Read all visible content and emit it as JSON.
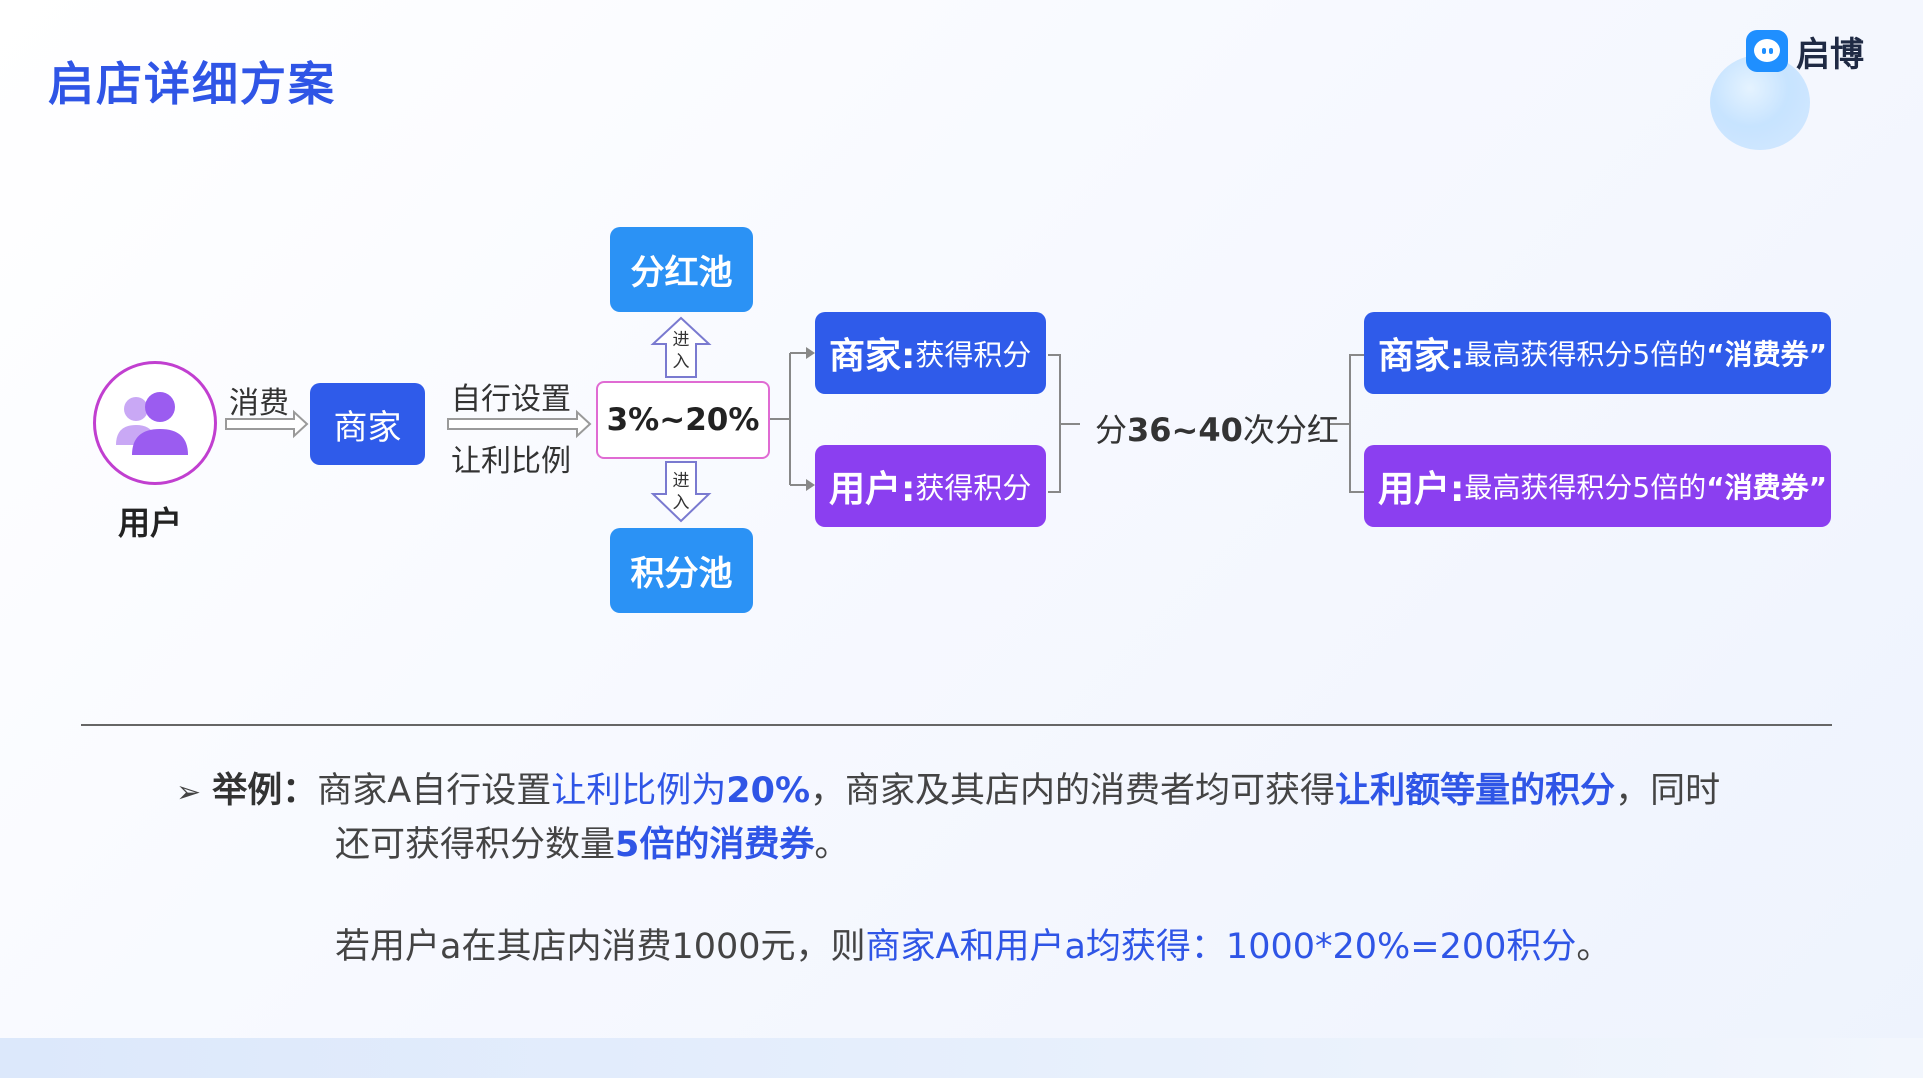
{
  "title": "启店详细方案",
  "logo": {
    "text": "启博",
    "brand_color": "#1f8fff"
  },
  "diagram": {
    "user_label": "用户",
    "consume_label": "消费",
    "merchant_label": "商家",
    "setting_label_1": "自行设置",
    "setting_label_2": "让利比例",
    "percent_range": "3%~20%",
    "enter_label": "进入",
    "bonus_pool": "分红池",
    "points_pool": "积分池",
    "merchant_points": {
      "prefix": "商家:",
      "text": "获得积分"
    },
    "user_points": {
      "prefix": "用户:",
      "text": "获得积分"
    },
    "dividend": {
      "prefix": "分",
      "bold": "36~40",
      "suffix": "次分红"
    },
    "merchant_voucher": {
      "prefix": "商家:",
      "text": "最高获得积分5倍的",
      "highlight": "“消费券”"
    },
    "user_voucher": {
      "prefix": "用户:",
      "text": "最高获得积分5倍的",
      "highlight": "“消费券”"
    },
    "colors": {
      "blue": "#2f5bea",
      "purple": "#8b3ff0",
      "sky": "#2b92f5",
      "pink_border": "#e06bd3",
      "title_blue": "#2f55e6"
    }
  },
  "example": {
    "bullet": "➢",
    "label": "举例：",
    "line1": {
      "a": "商家A自行设置",
      "b": "让利比例为",
      "c": "20%",
      "d": "，商家及其店内的消费者均可获得",
      "e": "让利额等量的积分",
      "f": "，同时"
    },
    "line2": {
      "a": "还可获得积分数量",
      "b": "5倍的消费券",
      "c": "。"
    },
    "line3": {
      "a": "若用户a在其店内消费1000元，则",
      "b": "商家A和用户a均获得：1000*20%=200积分",
      "c": "。"
    }
  }
}
